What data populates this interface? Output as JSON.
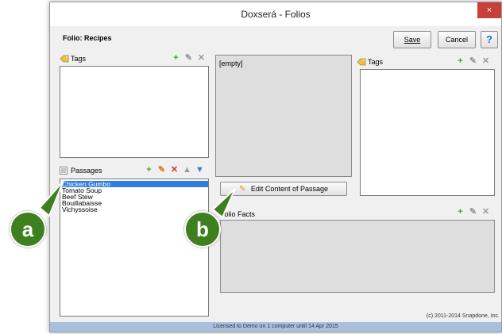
{
  "window": {
    "title": "Doxserá - Folios",
    "close_glyph": "×"
  },
  "header": {
    "folio_label": "Folio: Recipes",
    "save": "Save",
    "cancel": "Cancel",
    "help": "?"
  },
  "left_tags": {
    "label": "Tags",
    "icon": "tag-icon",
    "toolbar": {
      "add": "+",
      "edit": "✎",
      "delete": "✕"
    }
  },
  "passages": {
    "label": "Passages",
    "icon": "passages-icon",
    "toolbar": {
      "add": "+",
      "edit": "✎",
      "delete": "✕",
      "up": "▲",
      "down": "▼"
    },
    "items": [
      "Chicken Gumbo",
      "Tomato Soup",
      "Beef Stew",
      "Bouillabaisse",
      "Vichyssoise"
    ],
    "selected_index": 0
  },
  "content": {
    "text": "[empty]",
    "edit_button": "Edit Content of Passage"
  },
  "right_tags": {
    "label": "Tags",
    "icon": "tag-icon",
    "toolbar": {
      "add": "+",
      "edit": "✎",
      "delete": "✕"
    }
  },
  "folio_facts": {
    "label": "Folio Facts",
    "toolbar": {
      "add": "+",
      "edit": "✎",
      "delete": "✕"
    }
  },
  "copyright": "(c) 2011-2014 Snapdone, Inc.",
  "status_bar": "Licensed to Demo on 1 computer until 14 Apr 2015",
  "callouts": {
    "a": "a",
    "b": "b"
  },
  "colors": {
    "selection": "#2f7de1",
    "callout": "#3e7f1f",
    "status_bar": "#a9c1de",
    "close": "#c9403a"
  }
}
